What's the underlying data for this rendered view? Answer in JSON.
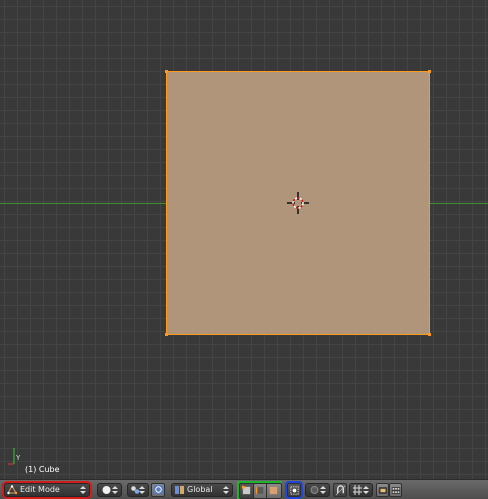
{
  "viewport": {
    "object_label": "(1) Cube",
    "axis_y_label": "Y"
  },
  "header": {
    "mode_selector": {
      "label": "Edit Mode",
      "icon": "edit-mode-icon"
    },
    "shading_selector": {
      "icon": "solid-sphere-icon"
    },
    "pivot_selector": {
      "icon": "pivot-point-icon"
    },
    "manipulator_toggle": {
      "icon": "manipulator-icon"
    },
    "orientation_selector": {
      "label": "Global",
      "icon": "orientation-icon"
    },
    "select_mode_buttons": [
      {
        "name": "vertex-select",
        "icon": "vertex-select-icon"
      },
      {
        "name": "edge-select",
        "icon": "edge-select-icon"
      },
      {
        "name": "face-select",
        "icon": "face-select-icon"
      }
    ],
    "occlude_toggle": {
      "icon": "limit-selection-icon"
    },
    "proportional_edit": {
      "icon": "proportional-edit-icon"
    },
    "snap_toggle": {
      "icon": "snap-icon"
    },
    "snap_element": {
      "icon": "snap-increment-icon"
    },
    "render_buttons": [
      {
        "icon": "render-preview-icon"
      },
      {
        "icon": "render-anim-icon"
      }
    ]
  },
  "colors": {
    "highlight_red": "#d21c1c",
    "highlight_green": "#1eb42d",
    "highlight_blue": "#2046d8",
    "selection_orange": "#ff9a1c",
    "face_fill": "#b0957a"
  }
}
